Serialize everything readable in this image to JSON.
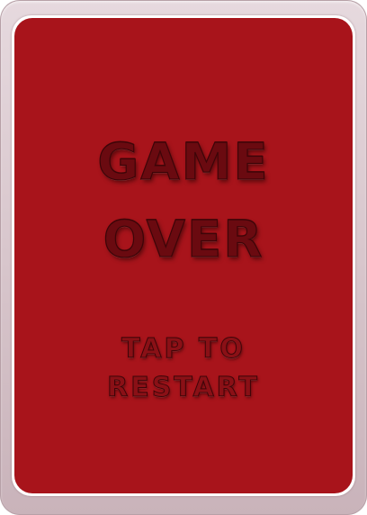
{
  "game_over": {
    "title_line_1": "GAME",
    "title_line_2": "OVER",
    "restart_line_1": "TAP TO",
    "restart_line_2": "RESTART"
  },
  "colors": {
    "card_face": "#a8141b",
    "card_frame": "#d8c6cc",
    "text": "#6a0a10"
  }
}
